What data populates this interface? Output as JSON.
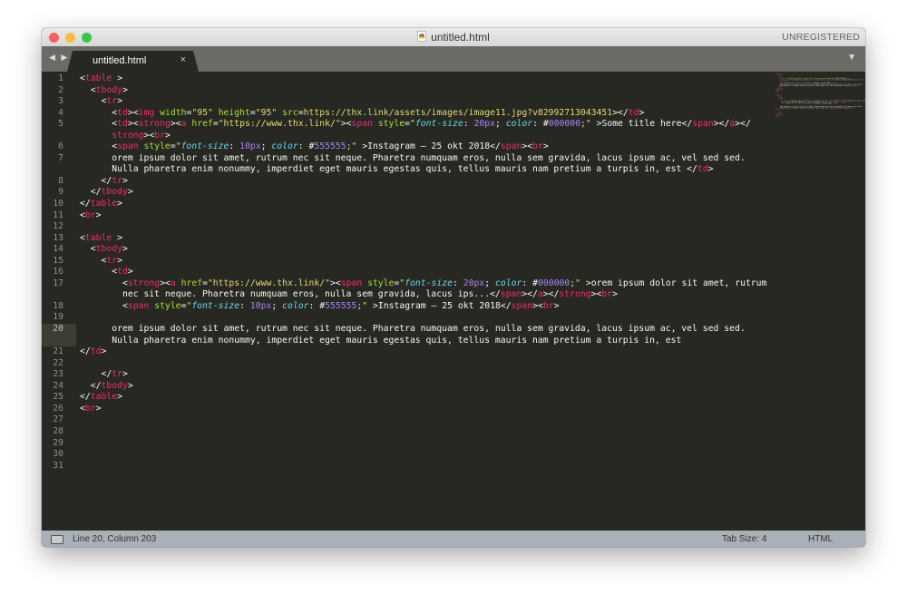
{
  "window": {
    "title": "untitled.html",
    "registration": "UNREGISTERED"
  },
  "traffic_lights": {
    "close": "#fc605c",
    "minimize": "#fdbc40",
    "zoom": "#34c84a"
  },
  "tabbar": {
    "nav_icon": "◀ ▶",
    "menu_icon": "▼",
    "tabs": [
      {
        "label": "untitled.html",
        "close": "×"
      }
    ]
  },
  "status": {
    "position": "Line 20, Column 203",
    "tab_size": "Tab Size: 4",
    "syntax": "HTML"
  },
  "editor": {
    "current_line": "20",
    "rows": [
      {
        "n": "1",
        "tk": [
          [
            "t",
            "<"
          ],
          [
            "tag",
            "table"
          ],
          [
            "t",
            " >"
          ]
        ]
      },
      {
        "n": "2",
        "tk": [
          [
            "t",
            "  <"
          ],
          [
            "tag",
            "tbody"
          ],
          [
            "t",
            ">"
          ]
        ]
      },
      {
        "n": "3",
        "tk": [
          [
            "t",
            "    <"
          ],
          [
            "tag",
            "tr"
          ],
          [
            "t",
            ">"
          ]
        ]
      },
      {
        "n": "4",
        "tk": [
          [
            "t",
            "      <"
          ],
          [
            "tag",
            "td"
          ],
          [
            "t",
            "><"
          ],
          [
            "tag",
            "img"
          ],
          [
            "t",
            " "
          ],
          [
            "attr",
            "width"
          ],
          [
            "t",
            "="
          ],
          [
            "str",
            "\"95\""
          ],
          [
            "t",
            " "
          ],
          [
            "attr",
            "height"
          ],
          [
            "t",
            "="
          ],
          [
            "str",
            "\"95\""
          ],
          [
            "t",
            " "
          ],
          [
            "attr",
            "src"
          ],
          [
            "t",
            "="
          ],
          [
            "str",
            "https://thx.link/assets/images/image11.jpg?v82992713043451"
          ],
          [
            "t",
            "></"
          ],
          [
            "tag",
            "td"
          ],
          [
            "t",
            ">"
          ]
        ]
      },
      {
        "n": "5",
        "tk": [
          [
            "t",
            "      <"
          ],
          [
            "tag",
            "td"
          ],
          [
            "t",
            "><"
          ],
          [
            "tag",
            "strong"
          ],
          [
            "t",
            "><"
          ],
          [
            "tag",
            "a"
          ],
          [
            "t",
            " "
          ],
          [
            "attr",
            "href"
          ],
          [
            "t",
            "="
          ],
          [
            "str",
            "\"https://www.thx.link/\""
          ],
          [
            "t",
            "><"
          ],
          [
            "tag",
            "span"
          ],
          [
            "t",
            " "
          ],
          [
            "attr",
            "style"
          ],
          [
            "t",
            "="
          ],
          [
            "str",
            "\""
          ],
          [
            "ital",
            "font-size"
          ],
          [
            "t",
            ": "
          ],
          [
            "num",
            "20px"
          ],
          [
            "t",
            "; "
          ],
          [
            "ital",
            "color"
          ],
          [
            "t",
            ": #"
          ],
          [
            "num",
            "000000"
          ],
          [
            "str",
            ";\""
          ],
          [
            "t",
            " >Some title here</"
          ],
          [
            "tag",
            "span"
          ],
          [
            "t",
            "></"
          ],
          [
            "tag",
            "a"
          ],
          [
            "t",
            "></"
          ]
        ]
      },
      {
        "n": "",
        "tk": [
          [
            "t",
            "      "
          ],
          [
            "tag",
            "strong"
          ],
          [
            "t",
            "><"
          ],
          [
            "tag",
            "br"
          ],
          [
            "t",
            ">"
          ]
        ]
      },
      {
        "n": "6",
        "tk": [
          [
            "t",
            "      <"
          ],
          [
            "tag",
            "span"
          ],
          [
            "t",
            " "
          ],
          [
            "attr",
            "style"
          ],
          [
            "t",
            "="
          ],
          [
            "str",
            "\""
          ],
          [
            "ital",
            "font-size"
          ],
          [
            "t",
            ": "
          ],
          [
            "num",
            "10px"
          ],
          [
            "t",
            "; "
          ],
          [
            "ital",
            "color"
          ],
          [
            "t",
            ": #"
          ],
          [
            "num",
            "555555"
          ],
          [
            "str",
            ";\""
          ],
          [
            "t",
            " >Instagram – 25 okt 2018</"
          ],
          [
            "tag",
            "span"
          ],
          [
            "t",
            "><"
          ],
          [
            "tag",
            "br"
          ],
          [
            "t",
            ">"
          ]
        ]
      },
      {
        "n": "7",
        "tk": [
          [
            "t",
            "      orem ipsum dolor sit amet, rutrum nec sit neque. Pharetra numquam eros, nulla sem gravida, lacus ipsum ac, vel sed sed."
          ]
        ]
      },
      {
        "n": "",
        "tk": [
          [
            "t",
            "      Nulla pharetra enim nonummy, imperdiet eget mauris egestas quis, tellus mauris nam pretium a turpis in, est </"
          ],
          [
            "tag",
            "td"
          ],
          [
            "t",
            ">"
          ]
        ]
      },
      {
        "n": "8",
        "tk": [
          [
            "t",
            "    </"
          ],
          [
            "tag",
            "tr"
          ],
          [
            "t",
            ">"
          ]
        ]
      },
      {
        "n": "9",
        "tk": [
          [
            "t",
            "  </"
          ],
          [
            "tag",
            "tbody"
          ],
          [
            "t",
            ">"
          ]
        ]
      },
      {
        "n": "10",
        "tk": [
          [
            "t",
            "</"
          ],
          [
            "tag",
            "table"
          ],
          [
            "t",
            ">"
          ]
        ]
      },
      {
        "n": "11",
        "tk": [
          [
            "t",
            "<"
          ],
          [
            "tag",
            "br"
          ],
          [
            "t",
            ">"
          ]
        ]
      },
      {
        "n": "12",
        "tk": []
      },
      {
        "n": "13",
        "tk": [
          [
            "t",
            "<"
          ],
          [
            "tag",
            "table"
          ],
          [
            "t",
            " >"
          ]
        ]
      },
      {
        "n": "14",
        "tk": [
          [
            "t",
            "  <"
          ],
          [
            "tag",
            "tbody"
          ],
          [
            "t",
            ">"
          ]
        ]
      },
      {
        "n": "15",
        "tk": [
          [
            "t",
            "    <"
          ],
          [
            "tag",
            "tr"
          ],
          [
            "t",
            ">"
          ]
        ]
      },
      {
        "n": "16",
        "tk": [
          [
            "t",
            "      <"
          ],
          [
            "tag",
            "td"
          ],
          [
            "t",
            ">"
          ]
        ]
      },
      {
        "n": "17",
        "tk": [
          [
            "t",
            "        <"
          ],
          [
            "tag",
            "strong"
          ],
          [
            "t",
            "><"
          ],
          [
            "tag",
            "a"
          ],
          [
            "t",
            " "
          ],
          [
            "attr",
            "href"
          ],
          [
            "t",
            "="
          ],
          [
            "str",
            "\"https://www.thx.link/\""
          ],
          [
            "t",
            "><"
          ],
          [
            "tag",
            "span"
          ],
          [
            "t",
            " "
          ],
          [
            "attr",
            "style"
          ],
          [
            "t",
            "="
          ],
          [
            "str",
            "\""
          ],
          [
            "ital",
            "font-size"
          ],
          [
            "t",
            ": "
          ],
          [
            "num",
            "20px"
          ],
          [
            "t",
            "; "
          ],
          [
            "ital",
            "color"
          ],
          [
            "t",
            ": #"
          ],
          [
            "num",
            "000000"
          ],
          [
            "str",
            ";\""
          ],
          [
            "t",
            " >orem ipsum dolor sit amet, rutrum"
          ]
        ]
      },
      {
        "n": "",
        "tk": [
          [
            "t",
            "        nec sit neque. Pharetra numquam eros, nulla sem gravida, lacus ips...</"
          ],
          [
            "tag",
            "span"
          ],
          [
            "t",
            "></"
          ],
          [
            "tag",
            "a"
          ],
          [
            "t",
            "></"
          ],
          [
            "tag",
            "strong"
          ],
          [
            "t",
            "><"
          ],
          [
            "tag",
            "br"
          ],
          [
            "t",
            ">"
          ]
        ]
      },
      {
        "n": "18",
        "tk": [
          [
            "t",
            "        <"
          ],
          [
            "tag",
            "span"
          ],
          [
            "t",
            " "
          ],
          [
            "attr",
            "style"
          ],
          [
            "t",
            "="
          ],
          [
            "str",
            "\""
          ],
          [
            "ital",
            "font-size"
          ],
          [
            "t",
            ": "
          ],
          [
            "num",
            "10px"
          ],
          [
            "t",
            "; "
          ],
          [
            "ital",
            "color"
          ],
          [
            "t",
            ": #"
          ],
          [
            "num",
            "555555"
          ],
          [
            "str",
            ";\""
          ],
          [
            "t",
            " >Instagram – 25 okt 2018</"
          ],
          [
            "tag",
            "span"
          ],
          [
            "t",
            "><"
          ],
          [
            "tag",
            "br"
          ],
          [
            "t",
            ">"
          ]
        ]
      },
      {
        "n": "19",
        "tk": []
      },
      {
        "n": "20",
        "tk": [
          [
            "t",
            "      orem ipsum dolor sit amet, rutrum nec sit neque. Pharetra numquam eros, nulla sem gravida, lacus ipsum ac, vel sed sed."
          ]
        ]
      },
      {
        "n": "",
        "cur": true,
        "tk": [
          [
            "t",
            "      Nulla pharetra enim nonummy, imperdiet eget mauris egestas quis, tellus mauris nam pretium a turpis in, est"
          ]
        ]
      },
      {
        "n": "21",
        "tk": [
          [
            "t",
            "</"
          ],
          [
            "tag",
            "td"
          ],
          [
            "t",
            ">"
          ]
        ]
      },
      {
        "n": "22",
        "tk": []
      },
      {
        "n": "23",
        "tk": [
          [
            "t",
            "    </"
          ],
          [
            "tag",
            "tr"
          ],
          [
            "t",
            ">"
          ]
        ]
      },
      {
        "n": "24",
        "tk": [
          [
            "t",
            "  </"
          ],
          [
            "tag",
            "tbody"
          ],
          [
            "t",
            ">"
          ]
        ]
      },
      {
        "n": "25",
        "tk": [
          [
            "t",
            "</"
          ],
          [
            "tag",
            "table"
          ],
          [
            "t",
            ">"
          ]
        ]
      },
      {
        "n": "26",
        "tk": [
          [
            "t",
            "<"
          ],
          [
            "tag",
            "br"
          ],
          [
            "t",
            ">"
          ]
        ]
      },
      {
        "n": "27",
        "tk": []
      },
      {
        "n": "28",
        "tk": []
      },
      {
        "n": "29",
        "tk": []
      },
      {
        "n": "30",
        "tk": []
      },
      {
        "n": "31",
        "tk": []
      }
    ]
  }
}
